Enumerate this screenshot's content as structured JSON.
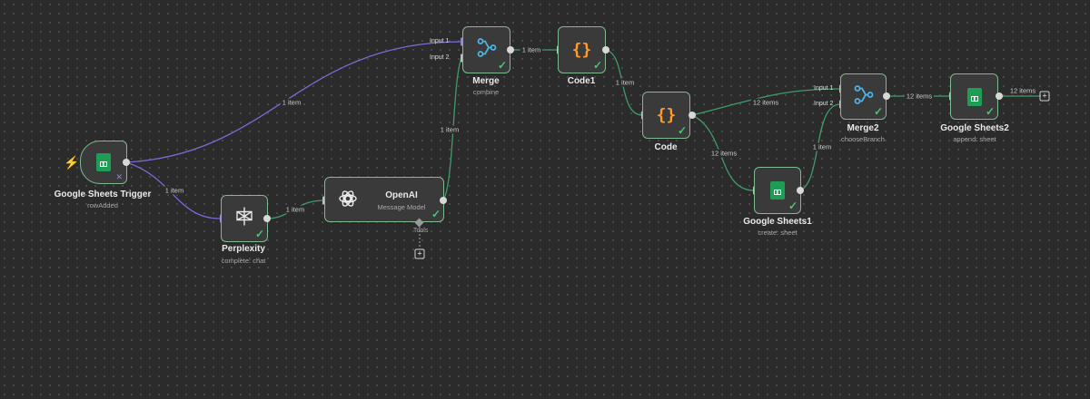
{
  "colors": {
    "canvas": "#2b2b2b",
    "success": "#4ec27a",
    "edge_success": "#3f9c6b",
    "edge_ai": "#7b6bd6",
    "trigger_bolt": "#ff6b4a"
  },
  "nodes": {
    "sheets_trigger": {
      "title": "Google Sheets Trigger",
      "subtitle": "rowAdded",
      "icon": "google-sheets-icon"
    },
    "perplexity": {
      "title": "Perplexity",
      "subtitle": "complete: chat",
      "icon": "perplexity-icon"
    },
    "openai": {
      "title": "OpenAI",
      "subtitle": "Message Model",
      "icon": "openai-icon",
      "tools_label": "Tools"
    },
    "merge": {
      "title": "Merge",
      "subtitle": "combine",
      "icon": "merge-icon",
      "input1": "Input 1",
      "input2": "Input 2"
    },
    "code1": {
      "title": "Code1",
      "icon": "code-braces-icon"
    },
    "code": {
      "title": "Code",
      "icon": "code-braces-icon"
    },
    "merge2": {
      "title": "Merge2",
      "subtitle": "chooseBranch",
      "icon": "merge-icon",
      "input1": "Input 1",
      "input2": "Input 2"
    },
    "sheets1": {
      "title": "Google Sheets1",
      "subtitle": "create: sheet",
      "icon": "google-sheets-icon"
    },
    "sheets2": {
      "title": "Google Sheets2",
      "subtitle": "append: sheet",
      "icon": "google-sheets-icon"
    }
  },
  "edges": {
    "trigger_to_merge": "1 item",
    "trigger_to_perplexity": "1 item",
    "perplexity_to_openai": "1 item",
    "openai_to_merge": "1 item",
    "merge_to_code1": "1 item",
    "code1_to_code": "1 item",
    "code_to_merge2": "12 items",
    "code_to_sheets1": "12 items",
    "sheets1_to_merge2": "1 item",
    "merge2_to_sheets2": "12 items",
    "sheets2_out": "12 items"
  }
}
